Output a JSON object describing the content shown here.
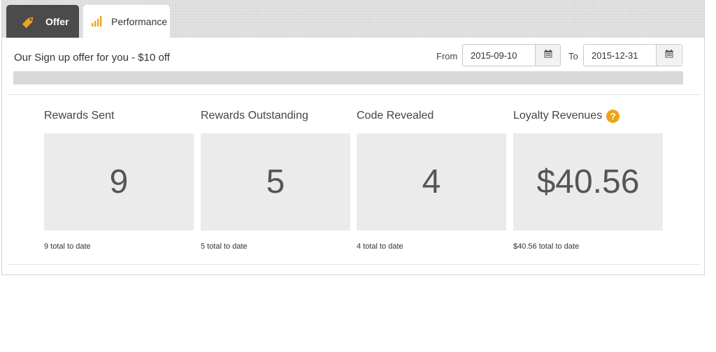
{
  "tabs": [
    {
      "label": "Offer",
      "icon": "price-tag-icon",
      "active": false
    },
    {
      "label": "Performance",
      "icon": "bar-chart-icon",
      "active": true
    }
  ],
  "offer_title": "Our Sign up offer for you - $10 off",
  "date_range": {
    "from_label": "From",
    "from_value": "2015-09-10",
    "to_label": "To",
    "to_value": "2015-12-31"
  },
  "progress": {
    "fraction": 0.0
  },
  "metrics": [
    {
      "title": "Rewards Sent",
      "value": "9",
      "subtitle": "9 total to date"
    },
    {
      "title": "Rewards Outstanding",
      "value": "5",
      "subtitle": "5 total to date"
    },
    {
      "title": "Code Revealed",
      "value": "4",
      "subtitle": "4 total to date"
    },
    {
      "title": "Loyalty Revenues",
      "value": "$40.56",
      "subtitle": "$40.56 total to date",
      "help_glyph": "?"
    }
  ],
  "colors": {
    "accent": "#f0a21b",
    "active_tab_bg": "#ffffff",
    "inactive_tab_bg": "#4b4b4b",
    "metric_box_bg": "#ebebeb"
  }
}
